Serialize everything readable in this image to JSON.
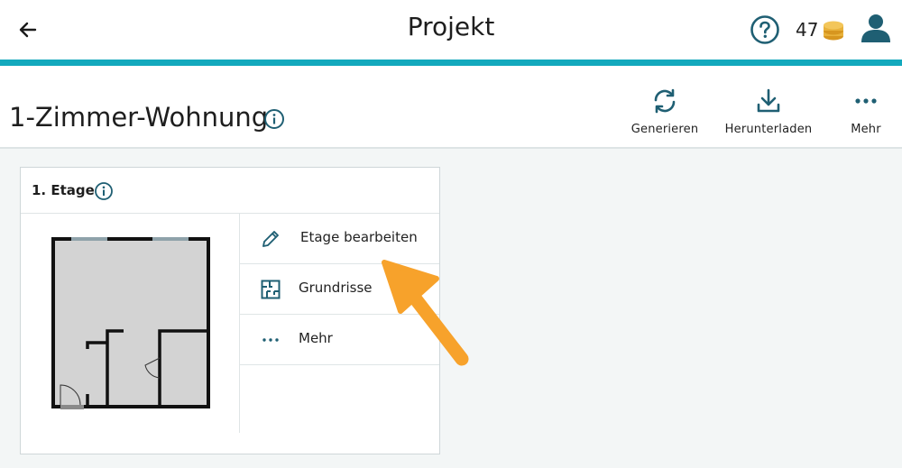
{
  "header": {
    "title": "Projekt",
    "credits_count": "47",
    "icons": {
      "back": "arrow-left-icon",
      "help": "question-circle-icon",
      "coins": "coin-stack-icon",
      "user": "user-icon"
    }
  },
  "project": {
    "name": "1-Zimmer-Wohnung",
    "actions": [
      {
        "label": "Generieren",
        "icon": "refresh-icon"
      },
      {
        "label": "Herunterladen",
        "icon": "download-icon"
      },
      {
        "label": "Mehr",
        "icon": "more-horizontal-icon"
      }
    ]
  },
  "floor_card": {
    "title": "1. Etage",
    "menu": [
      {
        "label": "Etage bearbeiten",
        "icon": "pencil-icon"
      },
      {
        "label": "Grundrisse",
        "icon": "floorplan-icon"
      },
      {
        "label": "Mehr",
        "icon": "more-horizontal-icon"
      }
    ]
  },
  "colors": {
    "accent": "#13a9bd",
    "icon_teal": "#1f5f73",
    "coin": "#e8b13a",
    "highlight_arrow": "#f7a22b",
    "background": "#f3f6f6"
  }
}
